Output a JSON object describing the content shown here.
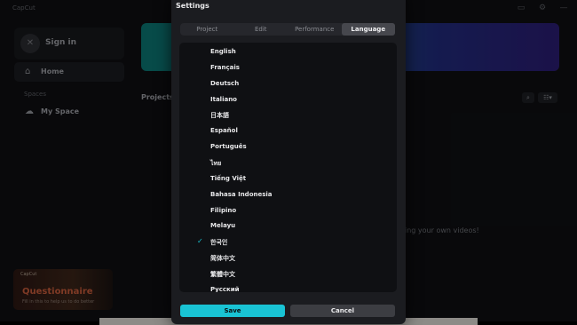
{
  "app": {
    "logo_text": "CapCut",
    "signin_label": "Sign in",
    "home_label": "Home",
    "spaces_heading": "Spaces",
    "my_space_label": "My Space",
    "projects_heading": "Projects",
    "empty_message": "ing your own videos!",
    "promo": {
      "brand": "CapCut",
      "title": "Questionnaire",
      "subtitle": "Fill in this to help us to do better"
    }
  },
  "settings": {
    "title": "Settings",
    "tabs": [
      {
        "label": "Project",
        "active": false
      },
      {
        "label": "Edit",
        "active": false
      },
      {
        "label": "Performance",
        "active": false
      },
      {
        "label": "Language",
        "active": true
      }
    ],
    "languages": [
      {
        "label": "English",
        "selected": false
      },
      {
        "label": "Français",
        "selected": false
      },
      {
        "label": "Deutsch",
        "selected": false
      },
      {
        "label": "Italiano",
        "selected": false
      },
      {
        "label": "日本語",
        "selected": false
      },
      {
        "label": "Español",
        "selected": false
      },
      {
        "label": "Português",
        "selected": false
      },
      {
        "label": "ไทย",
        "selected": false
      },
      {
        "label": "Tiếng Việt",
        "selected": false
      },
      {
        "label": "Bahasa Indonesia",
        "selected": false
      },
      {
        "label": "Filipino",
        "selected": false
      },
      {
        "label": "Melayu",
        "selected": false
      },
      {
        "label": "한국인",
        "selected": true
      },
      {
        "label": "简体中文",
        "selected": false
      },
      {
        "label": "繁體中文",
        "selected": false
      },
      {
        "label": "Русский",
        "selected": false
      }
    ],
    "save_label": "Save",
    "cancel_label": "Cancel",
    "check_glyph": "✓",
    "accent_color": "#19c3d4"
  }
}
